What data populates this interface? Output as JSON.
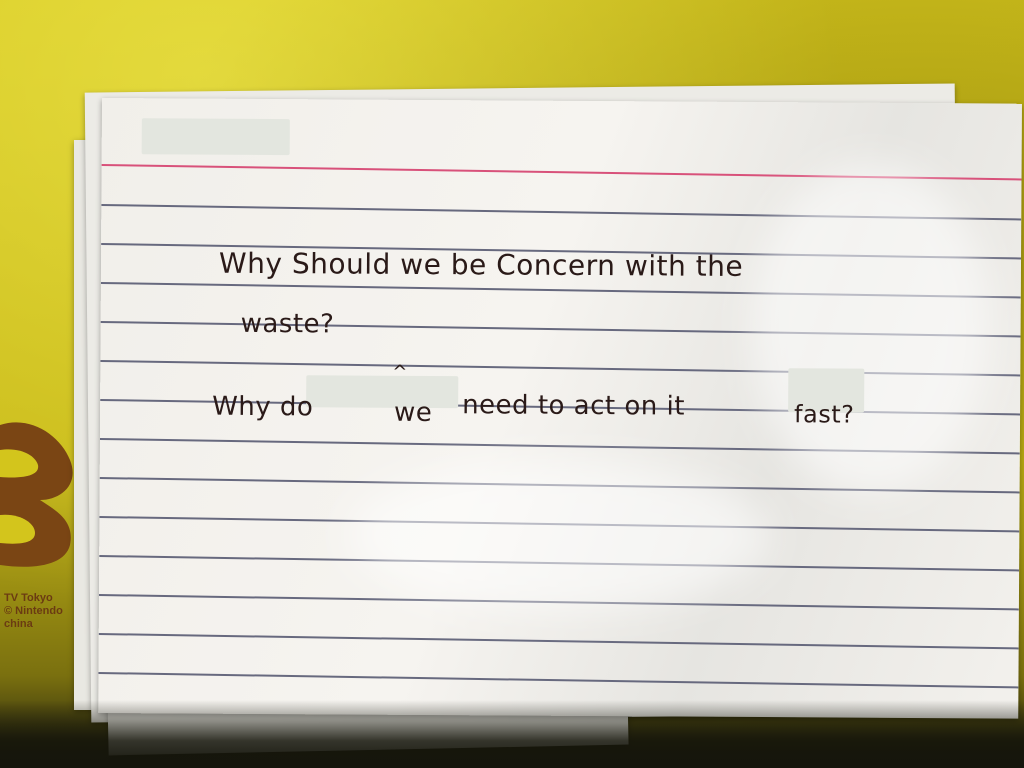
{
  "card": {
    "line1": "Why Should we be Concern with the",
    "line2": "waste?",
    "line3_a": "Why do",
    "line3_b": "we",
    "line3_c": "need to act on it",
    "line3_d": "fast?",
    "caret": "^"
  },
  "background_print": {
    "line1": "TV Tokyo",
    "line2": "© Nintendo",
    "line3": "china"
  },
  "colors": {
    "tablecloth": "#d3c51c",
    "card_paper": "#f4f2ee",
    "margin_rule": "#d8517a",
    "ruled_line": "#67697e",
    "ink": "#2a1a18",
    "print_brown": "#6b3b12"
  }
}
